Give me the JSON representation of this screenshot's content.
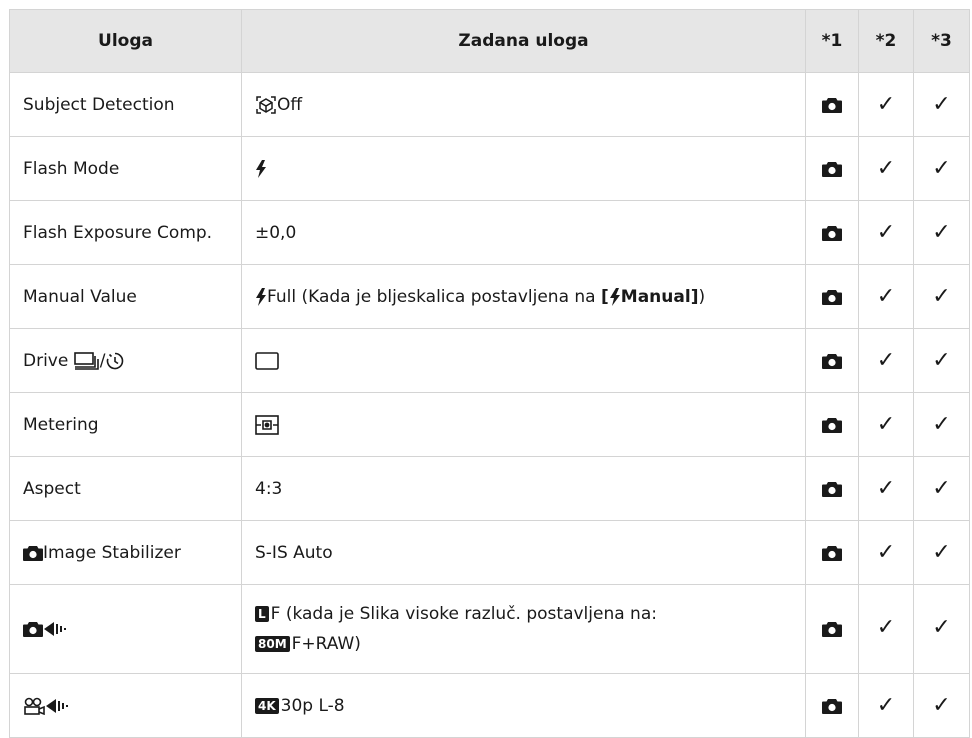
{
  "table": {
    "headers": [
      "Uloga",
      "Zadana uloga",
      "*1",
      "*2",
      "*3"
    ],
    "check_mark": "✓",
    "rows": [
      {
        "function": "Subject Detection",
        "value": "Off"
      },
      {
        "function": "Flash Mode",
        "value": ""
      },
      {
        "function": "Flash Exposure Comp.",
        "value": "±0,0"
      },
      {
        "function": "Manual Value",
        "value_a": "Full (Kada je bljeskalica postavljena na ",
        "value_b_open": "[",
        "value_b": "Manual",
        "value_b_close": "]",
        "value_c": ")"
      },
      {
        "function": "Drive ",
        "function_sep": "/"
      },
      {
        "function": "Metering",
        "value": ""
      },
      {
        "function": "Aspect",
        "value": "4:3"
      },
      {
        "function": "Image Stabilizer",
        "value": "S-IS Auto"
      },
      {
        "function": "",
        "value_a": "F (kada je Slika visoke razluč. postavljena na:",
        "value_tag": "80M",
        "value_b": "F+RAW)"
      },
      {
        "function": "",
        "value_tag": "4K",
        "value": "30p L-8"
      }
    ]
  }
}
